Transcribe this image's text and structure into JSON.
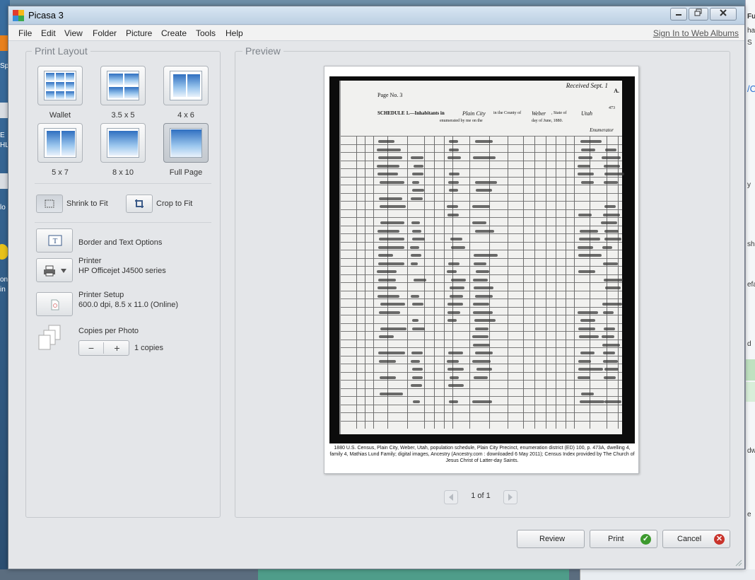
{
  "window": {
    "title": "Picasa 3"
  },
  "menu": {
    "items": [
      "File",
      "Edit",
      "View",
      "Folder",
      "Picture",
      "Create",
      "Tools",
      "Help"
    ],
    "sign_in": "Sign In to Web Albums"
  },
  "print_layout": {
    "title": "Print Layout",
    "layouts": [
      {
        "label": "Wallet",
        "selected": false
      },
      {
        "label": "3.5 x 5",
        "selected": false
      },
      {
        "label": "4 x 6",
        "selected": false
      },
      {
        "label": "5 x 7",
        "selected": false
      },
      {
        "label": "8 x 10",
        "selected": false
      },
      {
        "label": "Full Page",
        "selected": true
      }
    ],
    "shrink_to_fit": "Shrink to Fit",
    "crop_to_fit": "Crop to Fit",
    "border_text": "Border and Text Options",
    "printer_label": "Printer",
    "printer_name": "HP Officejet J4500 series",
    "printer_setup_label": "Printer Setup",
    "printer_setup_value": "600.0 dpi, 8.5 x 11.0 (Online)",
    "copies_label": "Copies per Photo",
    "copies_value": "1 copies",
    "minus": "−",
    "plus": "+"
  },
  "preview": {
    "title": "Preview",
    "document": {
      "header_right": "Received Sept. 1",
      "page_no": "Page No. 3",
      "schedule": "SCHEDULE 1.—Inhabitants in",
      "place": "Plain City",
      "county_text": "in the County of",
      "county": "Weber",
      "state_text": ", State of",
      "state": "Utah",
      "enumerated": "enumerated by me on the",
      "date": "day of June, 1880.",
      "enumerator": "Enumerator",
      "sheet_no": "473",
      "corner": "A."
    },
    "caption": "1880 U.S. Census, Plain City, Weber, Utah, population schedule, Plain City Precinct, enumeration district (ED) 100, p. 473A, dwelling 4, family 4, Mathias Lund Family; digital images, Ancestry (Ancestry.com : downloaded 6 May 2011); Census Index provided by The Church of Jesus Christ of Latter-day Saints.",
    "page_count": "1 of 1"
  },
  "actions": {
    "review": "Review",
    "print": "Print",
    "cancel": "Cancel"
  },
  "colors": {
    "print_ok": "#3d9a2e",
    "cancel_x": "#c9342c"
  },
  "background": {
    "left_fragments": [
      "Sp",
      "E",
      "HL",
      "lo",
      "on",
      "in"
    ],
    "right_fragments": [
      "Fu",
      "ha",
      "S",
      "/C",
      "y",
      "sh",
      "efa",
      "d",
      "dw",
      "e"
    ]
  }
}
